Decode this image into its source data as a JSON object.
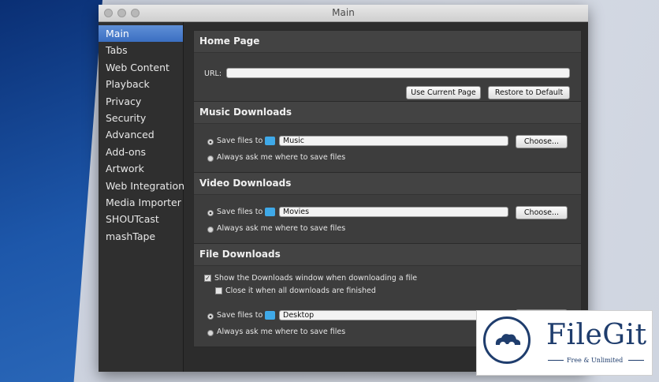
{
  "window": {
    "title": "Main"
  },
  "sidebar": {
    "items": [
      {
        "label": "Main"
      },
      {
        "label": "Tabs"
      },
      {
        "label": "Web Content"
      },
      {
        "label": "Playback"
      },
      {
        "label": "Privacy"
      },
      {
        "label": "Security"
      },
      {
        "label": "Advanced"
      },
      {
        "label": "Add-ons"
      },
      {
        "label": "Artwork"
      },
      {
        "label": "Web Integration"
      },
      {
        "label": "Media Importer"
      },
      {
        "label": "SHOUTcast"
      },
      {
        "label": "mashTape"
      }
    ],
    "active_index": 0
  },
  "home_page": {
    "title": "Home Page",
    "url_label": "URL:",
    "url_value": "",
    "use_current_label": "Use Current Page",
    "restore_default_label": "Restore to Default"
  },
  "music_downloads": {
    "title": "Music Downloads",
    "save_label": "Save files to",
    "folder": "Music",
    "choose_label": "Choose...",
    "ask_label": "Always ask me where to save files",
    "selected": "save"
  },
  "video_downloads": {
    "title": "Video Downloads",
    "save_label": "Save files to",
    "folder": "Movies",
    "choose_label": "Choose...",
    "ask_label": "Always ask me where to save files",
    "selected": "save"
  },
  "file_downloads": {
    "title": "File Downloads",
    "show_window_label": "Show the Downloads window when downloading a file",
    "show_window_checked": true,
    "close_label": "Close it when all downloads are finished",
    "close_checked": false,
    "save_label": "Save files to",
    "folder": "Desktop",
    "ask_label": "Always ask me where to save files",
    "selected": "save"
  },
  "watermark": {
    "brand": "FileGit",
    "tagline": "Free & Unlimited"
  },
  "colors": {
    "accent": "#3b6fc2",
    "folder_blue": "#3fa9e8",
    "brand": "#1f3d6d"
  }
}
